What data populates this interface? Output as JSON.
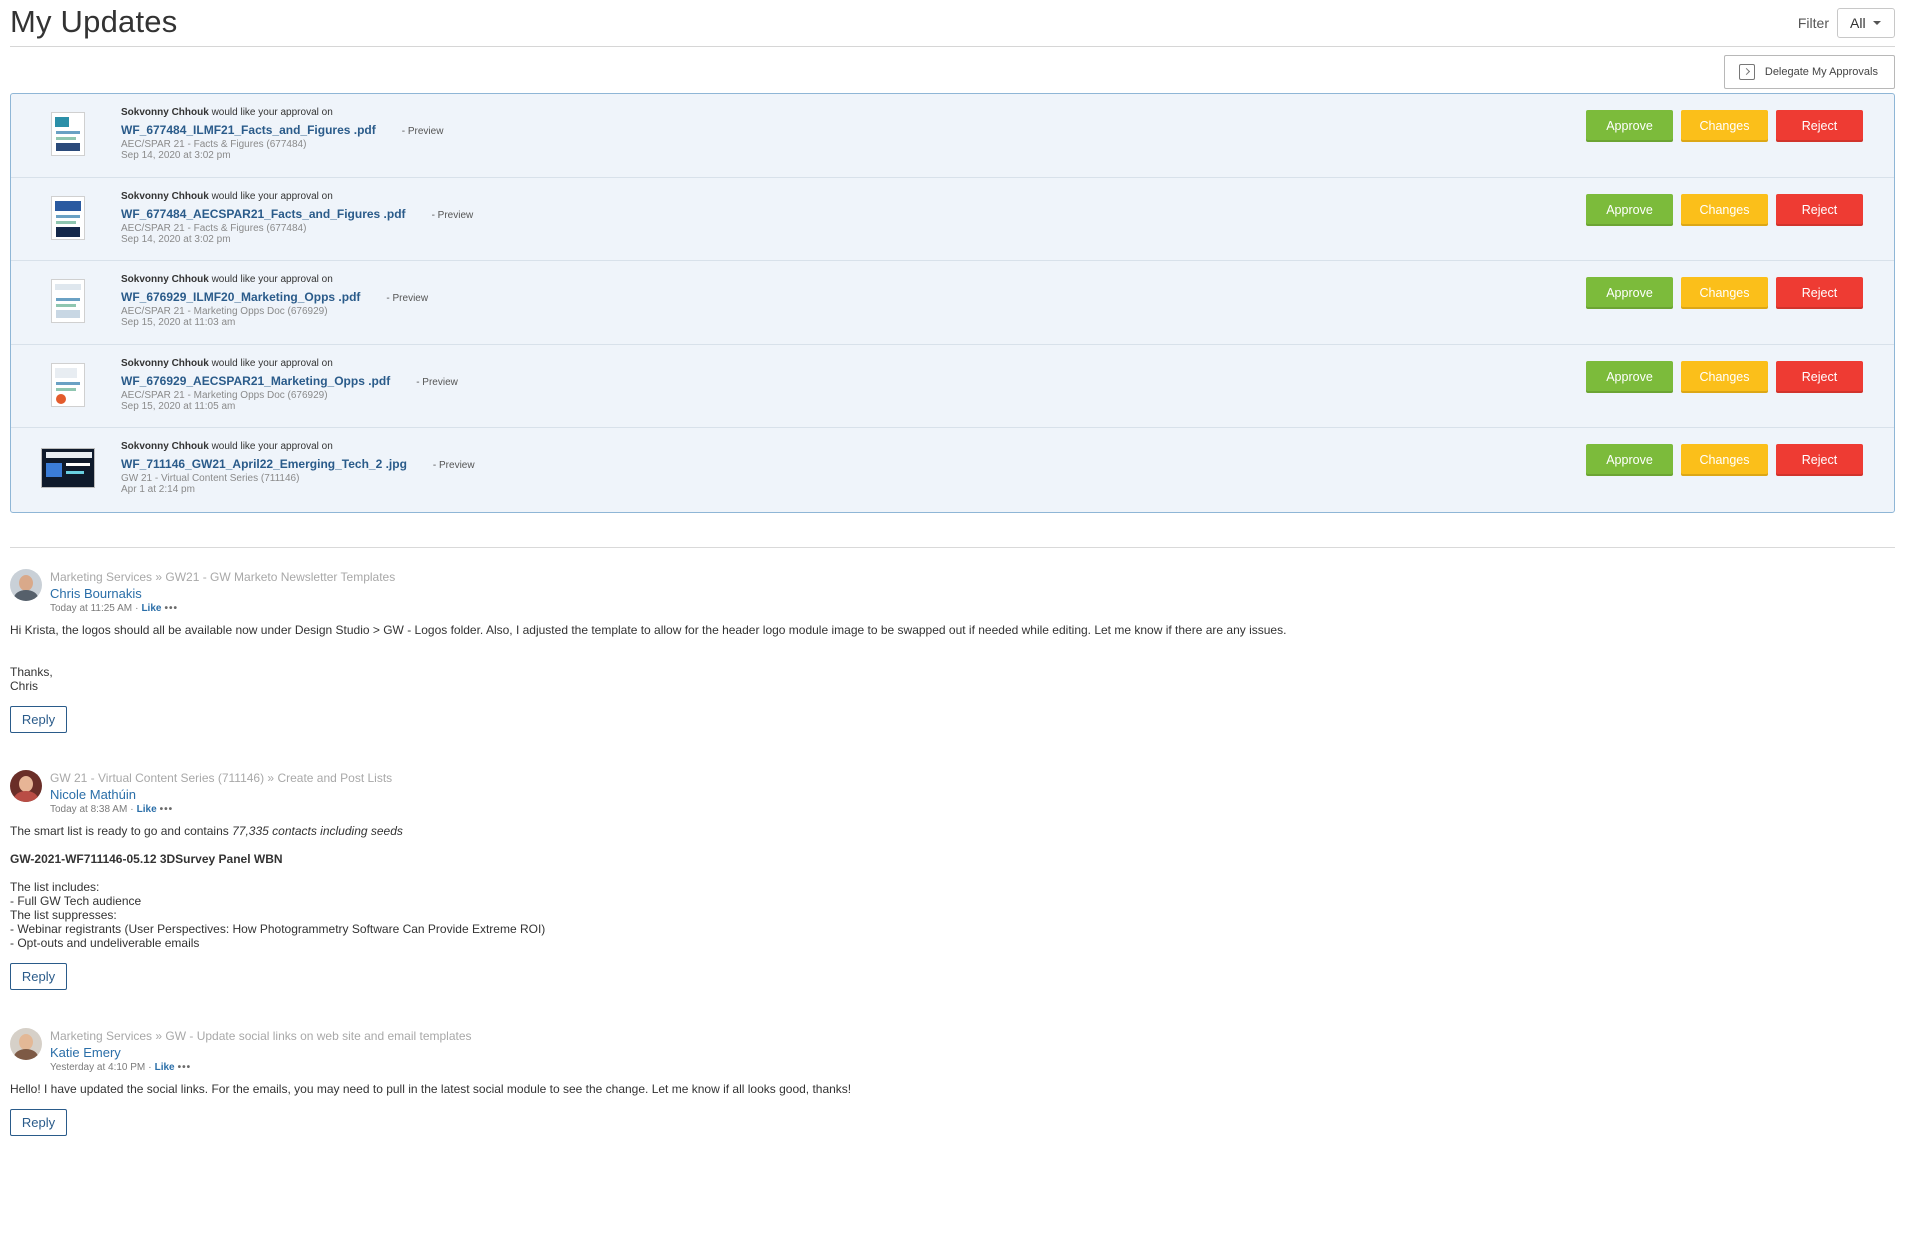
{
  "header": {
    "title": "My Updates",
    "filter_label": "Filter",
    "filter_value": "All"
  },
  "delegate": {
    "label": "Delegate My Approvals"
  },
  "approvals": [
    {
      "requester": "Sokvonny Chhouk",
      "request_text": "would like your approval on",
      "file": "WF_677484_ILMF21_Facts_and_Figures .pdf",
      "preview": "- Preview",
      "project": "AEC/SPAR 21 - Facts & Figures (677484)",
      "date": "Sep 14, 2020 at 3:02 pm",
      "approve": "Approve",
      "changes": "Changes",
      "reject": "Reject"
    },
    {
      "requester": "Sokvonny Chhouk",
      "request_text": "would like your approval on",
      "file": "WF_677484_AECSPAR21_Facts_and_Figures .pdf",
      "preview": "- Preview",
      "project": "AEC/SPAR 21 - Facts & Figures (677484)",
      "date": "Sep 14, 2020 at 3:02 pm",
      "approve": "Approve",
      "changes": "Changes",
      "reject": "Reject"
    },
    {
      "requester": "Sokvonny Chhouk",
      "request_text": "would like your approval on",
      "file": "WF_676929_ILMF20_Marketing_Opps .pdf",
      "preview": "- Preview",
      "project": "AEC/SPAR 21 - Marketing Opps Doc (676929)",
      "date": "Sep 15, 2020 at 11:03 am",
      "approve": "Approve",
      "changes": "Changes",
      "reject": "Reject"
    },
    {
      "requester": "Sokvonny Chhouk",
      "request_text": "would like your approval on",
      "file": "WF_676929_AECSPAR21_Marketing_Opps .pdf",
      "preview": "- Preview",
      "project": "AEC/SPAR 21 - Marketing Opps Doc (676929)",
      "date": "Sep 15, 2020 at 11:05 am",
      "approve": "Approve",
      "changes": "Changes",
      "reject": "Reject"
    },
    {
      "requester": "Sokvonny Chhouk",
      "request_text": "would like your approval on",
      "file": "WF_711146_GW21_April22_Emerging_Tech_2 .jpg",
      "preview": "- Preview",
      "project": "GW 21 - Virtual Content Series (711146)",
      "date": "Apr 1 at 2:14 pm",
      "approve": "Approve",
      "changes": "Changes",
      "reject": "Reject"
    }
  ],
  "posts": [
    {
      "breadcrumb": "Marketing Services » GW21 - GW Marketo Newsletter Templates",
      "author": "Chris Bournakis",
      "time": "Today at 11:25 AM",
      "like": "Like",
      "more": "•••",
      "body": {
        "p1": "Hi Krista, the logos should all be available now under Design Studio > GW - Logos folder. Also, I adjusted the template to allow for the header logo module image to be swapped out if needed while editing. Let me know if there are any issues.",
        "p2": "Thanks,",
        "p3": "Chris"
      },
      "reply": "Reply"
    },
    {
      "breadcrumb": "GW 21 - Virtual Content Series (711146) » Create and Post Lists",
      "author": "Nicole Mathúin",
      "time": "Today at 8:38 AM",
      "like": "Like",
      "more": "•••",
      "body": {
        "p1_prefix": "The smart list is ready to go and contains ",
        "p1_italic": "77,335 contacts including seeds",
        "p2": "GW-2021-WF711146-05.12 3DSurvey Panel WBN",
        "l1": "The list includes:",
        "l2": " - Full GW Tech audience",
        "l3": "The list suppresses:",
        "l4": " - Webinar registrants (User Perspectives: How Photogrammetry Software Can Provide Extreme ROI)",
        "l5": " - Opt-outs and undeliverable emails"
      },
      "reply": "Reply"
    },
    {
      "breadcrumb": "Marketing Services » GW - Update social links on web site and email templates",
      "author": "Katie Emery",
      "time": "Yesterday at 4:10 PM",
      "like": "Like",
      "more": "•••",
      "body": {
        "p1": "Hello! I have updated the social links. For the emails, you may need to pull in the latest social module to see the change. Let me know if all looks good, thanks!"
      },
      "reply": "Reply"
    }
  ],
  "colors": {
    "approve": "#7cbb3b",
    "changes": "#fbbf1a",
    "reject": "#ee3b33",
    "link": "#2a5b8a",
    "panel_bg": "#eff4fa",
    "panel_border": "#8fb6d6"
  }
}
